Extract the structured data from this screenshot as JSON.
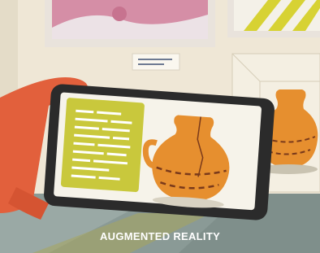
{
  "illustration": {
    "caption": "AUGMENTED REALITY",
    "colors": {
      "wall": "#efe7d6",
      "floor": "#8a9a96",
      "vase": "#e68f2f",
      "vase_dark": "#7a3a1b",
      "info_card": "#c9c83c",
      "hand": "#e2603c",
      "phone": "#2b2b2b",
      "painting_pink": "#d58ea6",
      "painting_frame": "#e9e3dc",
      "stripes": "#d7d233"
    },
    "icons": [
      "smartphone",
      "hand",
      "clay-jug",
      "painting",
      "info-card"
    ]
  }
}
